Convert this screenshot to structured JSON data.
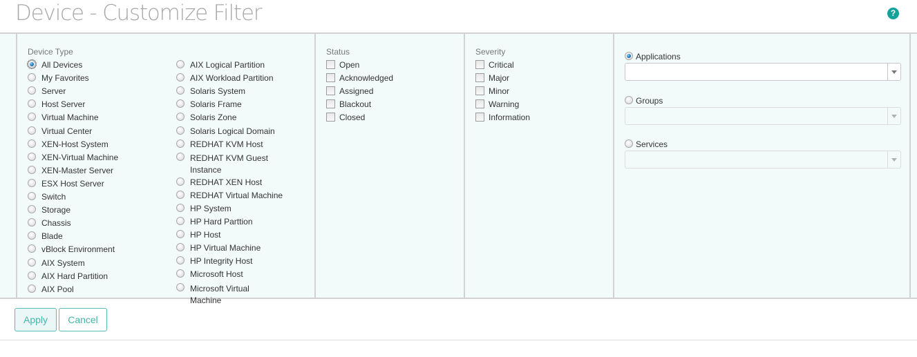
{
  "header": {
    "title": "Device - Customize Filter",
    "help_icon": "?"
  },
  "device_type": {
    "label": "Device Type",
    "selected": "All Devices",
    "column1": [
      "All Devices",
      "My Favorites",
      "Server",
      "Host Server",
      "Virtual Machine",
      "Virtual Center",
      "XEN-Host System",
      "XEN-Virtual Machine",
      "XEN-Master Server",
      "ESX Host Server",
      "Switch",
      "Storage",
      "Chassis",
      "Blade",
      "vBlock Environment",
      "AIX System",
      "AIX Hard Partition",
      "AIX Pool"
    ],
    "column2": [
      "AIX Logical Partition",
      "AIX Workload Partition",
      "Solaris System",
      "Solaris Frame",
      "Solaris Zone",
      "Solaris Logical Domain",
      "REDHAT KVM Host",
      "REDHAT KVM Guest Instance",
      "REDHAT XEN Host",
      "REDHAT Virtual Machine",
      "HP System",
      "HP Hard Parttion",
      "HP Host",
      "HP Virtual Machine",
      "HP Integrity Host",
      "Microsoft Host",
      "Microsoft Virtual Machine"
    ]
  },
  "status": {
    "label": "Status",
    "items": [
      {
        "label": "Open",
        "checked": false
      },
      {
        "label": "Acknowledged",
        "checked": false
      },
      {
        "label": "Assigned",
        "checked": false
      },
      {
        "label": "Blackout",
        "checked": false
      },
      {
        "label": "Closed",
        "checked": false
      }
    ]
  },
  "severity": {
    "label": "Severity",
    "items": [
      {
        "label": "Critical",
        "checked": false
      },
      {
        "label": "Major",
        "checked": false
      },
      {
        "label": "Minor",
        "checked": false
      },
      {
        "label": "Warning",
        "checked": false
      },
      {
        "label": "Information",
        "checked": false
      }
    ]
  },
  "scope": {
    "selected": "Applications",
    "options": [
      {
        "label": "Applications",
        "value": "",
        "enabled": true
      },
      {
        "label": "Groups",
        "value": "",
        "enabled": false
      },
      {
        "label": "Services",
        "value": "",
        "enabled": false
      }
    ]
  },
  "footer": {
    "apply_label": "Apply",
    "cancel_label": "Cancel"
  },
  "colors": {
    "accent": "#12a49a",
    "button_border": "#55bdb3",
    "panel_bg": "#f2fafa"
  }
}
